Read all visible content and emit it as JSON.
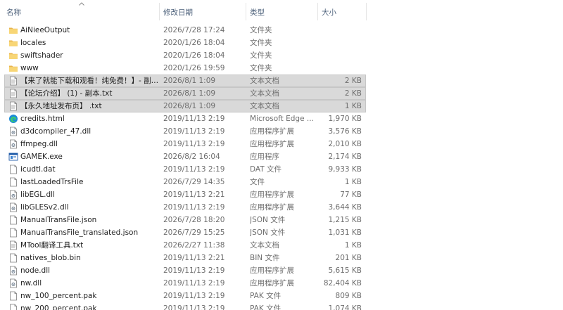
{
  "header": {
    "name": "名称",
    "date": "修改日期",
    "type": "类型",
    "size": "大小"
  },
  "files": [
    {
      "name": "AiNieeOutput",
      "date": "2026/7/28 17:24",
      "type": "文件夹",
      "size": "",
      "icon": "folder-icon",
      "selected": false
    },
    {
      "name": "locales",
      "date": "2020/1/26 18:04",
      "type": "文件夹",
      "size": "",
      "icon": "folder-icon",
      "selected": false
    },
    {
      "name": "swiftshader",
      "date": "2020/1/26 18:04",
      "type": "文件夹",
      "size": "",
      "icon": "folder-icon",
      "selected": false
    },
    {
      "name": "www",
      "date": "2020/1/26 19:59",
      "type": "文件夹",
      "size": "",
      "icon": "folder-icon",
      "selected": false
    },
    {
      "name": "【来了就能下载和观看！纯免费！】- 副本.txt",
      "date": "2026/8/1 1:09",
      "type": "文本文档",
      "size": "2 KB",
      "icon": "text-file-icon",
      "selected": true
    },
    {
      "name": "【论坛介绍】 (1) - 副本.txt",
      "date": "2026/8/1 1:09",
      "type": "文本文档",
      "size": "2 KB",
      "icon": "text-file-icon",
      "selected": true
    },
    {
      "name": "【永久地址发布页】 .txt",
      "date": "2026/8/1 1:09",
      "type": "文本文档",
      "size": "1 KB",
      "icon": "text-file-icon",
      "selected": true
    },
    {
      "name": "credits.html",
      "date": "2019/11/13 2:19",
      "type": "Microsoft Edge ...",
      "size": "1,970 KB",
      "icon": "edge-icon",
      "selected": false
    },
    {
      "name": "d3dcompiler_47.dll",
      "date": "2019/11/13 2:19",
      "type": "应用程序扩展",
      "size": "3,576 KB",
      "icon": "dll-file-icon",
      "selected": false
    },
    {
      "name": "ffmpeg.dll",
      "date": "2019/11/13 2:19",
      "type": "应用程序扩展",
      "size": "2,010 KB",
      "icon": "dll-file-icon",
      "selected": false
    },
    {
      "name": "GAMEK.exe",
      "date": "2026/8/2 16:04",
      "type": "应用程序",
      "size": "2,174 KB",
      "icon": "exe-icon",
      "selected": false
    },
    {
      "name": "icudtl.dat",
      "date": "2019/11/13 2:19",
      "type": "DAT 文件",
      "size": "9,933 KB",
      "icon": "blank-file-icon",
      "selected": false
    },
    {
      "name": "lastLoadedTrsFile",
      "date": "2026/7/29 14:35",
      "type": "文件",
      "size": "1 KB",
      "icon": "blank-file-icon",
      "selected": false
    },
    {
      "name": "libEGL.dll",
      "date": "2019/11/13 2:21",
      "type": "应用程序扩展",
      "size": "77 KB",
      "icon": "dll-file-icon",
      "selected": false
    },
    {
      "name": "libGLESv2.dll",
      "date": "2019/11/13 2:19",
      "type": "应用程序扩展",
      "size": "3,644 KB",
      "icon": "dll-file-icon",
      "selected": false
    },
    {
      "name": "ManualTransFile.json",
      "date": "2026/7/28 18:20",
      "type": "JSON 文件",
      "size": "1,215 KB",
      "icon": "blank-file-icon",
      "selected": false
    },
    {
      "name": "ManualTransFile_translated.json",
      "date": "2026/7/29 15:25",
      "type": "JSON 文件",
      "size": "1,031 KB",
      "icon": "blank-file-icon",
      "selected": false
    },
    {
      "name": "MTool翻译工具.txt",
      "date": "2026/2/27 11:38",
      "type": "文本文档",
      "size": "1 KB",
      "icon": "text-file-icon",
      "selected": false
    },
    {
      "name": "natives_blob.bin",
      "date": "2019/11/13 2:21",
      "type": "BIN 文件",
      "size": "201 KB",
      "icon": "blank-file-icon",
      "selected": false
    },
    {
      "name": "node.dll",
      "date": "2019/11/13 2:19",
      "type": "应用程序扩展",
      "size": "5,615 KB",
      "icon": "dll-file-icon",
      "selected": false
    },
    {
      "name": "nw.dll",
      "date": "2019/11/13 2:19",
      "type": "应用程序扩展",
      "size": "82,404 KB",
      "icon": "dll-file-icon",
      "selected": false
    },
    {
      "name": "nw_100_percent.pak",
      "date": "2019/11/13 2:19",
      "type": "PAK 文件",
      "size": "809 KB",
      "icon": "blank-file-icon",
      "selected": false
    },
    {
      "name": "nw_200_percent.pak",
      "date": "2019/11/13 2:19",
      "type": "PAK 文件",
      "size": "1,074 KB",
      "icon": "blank-file-icon",
      "selected": false
    }
  ]
}
